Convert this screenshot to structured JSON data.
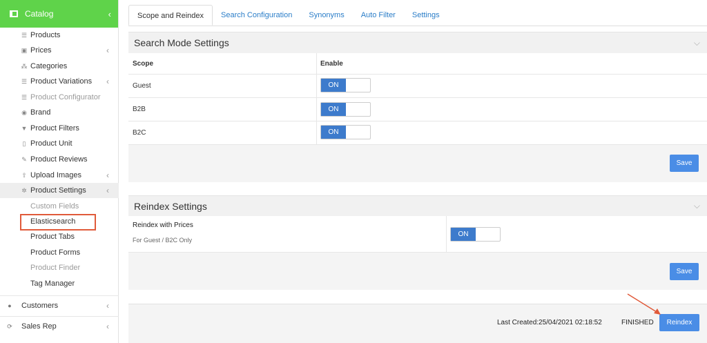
{
  "sidebar": {
    "header": "Catalog",
    "items": [
      {
        "label": "Products",
        "icon": "list-icon"
      },
      {
        "label": "Prices",
        "icon": "money-icon"
      },
      {
        "label": "Categories",
        "icon": "sitemap-icon"
      },
      {
        "label": "Product Variations",
        "icon": "list-icon"
      },
      {
        "label": "Product Configurator",
        "icon": "list-icon"
      },
      {
        "label": "Brand",
        "icon": "brand-icon"
      },
      {
        "label": "Product Filters",
        "icon": "filter-icon"
      },
      {
        "label": "Product Unit",
        "icon": "unit-icon"
      },
      {
        "label": "Product Reviews",
        "icon": "edit-icon"
      },
      {
        "label": "Upload Images",
        "icon": "upload-icon"
      },
      {
        "label": "Product Settings",
        "icon": "gear-icon"
      },
      {
        "label": "Custom Fields"
      },
      {
        "label": "Elasticsearch"
      },
      {
        "label": "Product Tabs"
      },
      {
        "label": "Product Forms"
      },
      {
        "label": "Product Finder"
      },
      {
        "label": "Tag Manager"
      }
    ],
    "sections": [
      {
        "label": "Customers",
        "icon": "user-icon"
      },
      {
        "label": "Sales Rep",
        "icon": "sync-icon"
      }
    ]
  },
  "tabs": [
    "Scope and Reindex",
    "Search Configuration",
    "Synonyms",
    "Auto Filter",
    "Settings"
  ],
  "search_mode": {
    "title": "Search Mode Settings",
    "col_scope": "Scope",
    "col_enable": "Enable",
    "rows": [
      {
        "scope": "Guest",
        "toggle": "ON"
      },
      {
        "scope": "B2B",
        "toggle": "ON"
      },
      {
        "scope": "B2C",
        "toggle": "ON"
      }
    ],
    "save": "Save"
  },
  "reindex": {
    "title": "Reindex Settings",
    "label": "Reindex with Prices",
    "sublabel": "For Guest / B2C Only",
    "toggle": "ON",
    "save": "Save"
  },
  "footer": {
    "last_created": "Last Created:25/04/2021 02:18:52",
    "status": "FINISHED",
    "reindex_button": "Reindex"
  },
  "colors": {
    "accent_green": "#5fd34a",
    "primary_blue": "#4a8de6",
    "toggle_blue": "#3d7bcc",
    "highlight_red": "#e05a3a"
  }
}
